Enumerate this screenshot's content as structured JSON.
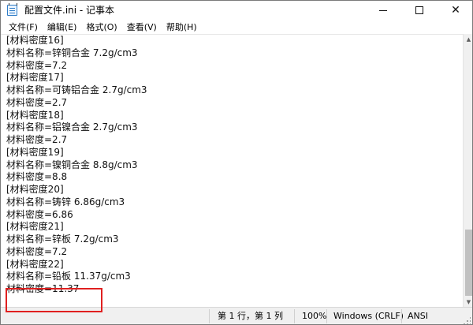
{
  "window": {
    "title": "配置文件.ini - 记事本"
  },
  "menu": [
    "文件(F)",
    "编辑(E)",
    "格式(O)",
    "查看(V)",
    "帮助(H)"
  ],
  "editor": {
    "lines": [
      "[材料密度16]",
      "材料名称=锌铜合金 7.2g/cm3",
      "材料密度=7.2",
      "[材料密度17]",
      "材料名称=可铸铝合金 2.7g/cm3",
      "材料密度=2.7",
      "[材料密度18]",
      "材料名称=铝镍合金 2.7g/cm3",
      "材料密度=2.7",
      "[材料密度19]",
      "材料名称=镍铜合金 8.8g/cm3",
      "材料密度=8.8",
      "[材料密度20]",
      "材料名称=铸锌 6.86g/cm3",
      "材料密度=6.86",
      "[材料密度21]",
      "材料名称=锌板 7.2g/cm3",
      "材料密度=7.2",
      "[材料密度22]",
      "材料名称=铅板 11.37g/cm3",
      "材料密度=11.37"
    ]
  },
  "statusbar": {
    "position": "第 1 行，第 1 列",
    "zoom": "100%",
    "line_ending": "Windows (CRLF)",
    "encoding": "ANSI"
  },
  "colors": {
    "annotation": "#e02020",
    "chrome": "#f0f0f0"
  }
}
